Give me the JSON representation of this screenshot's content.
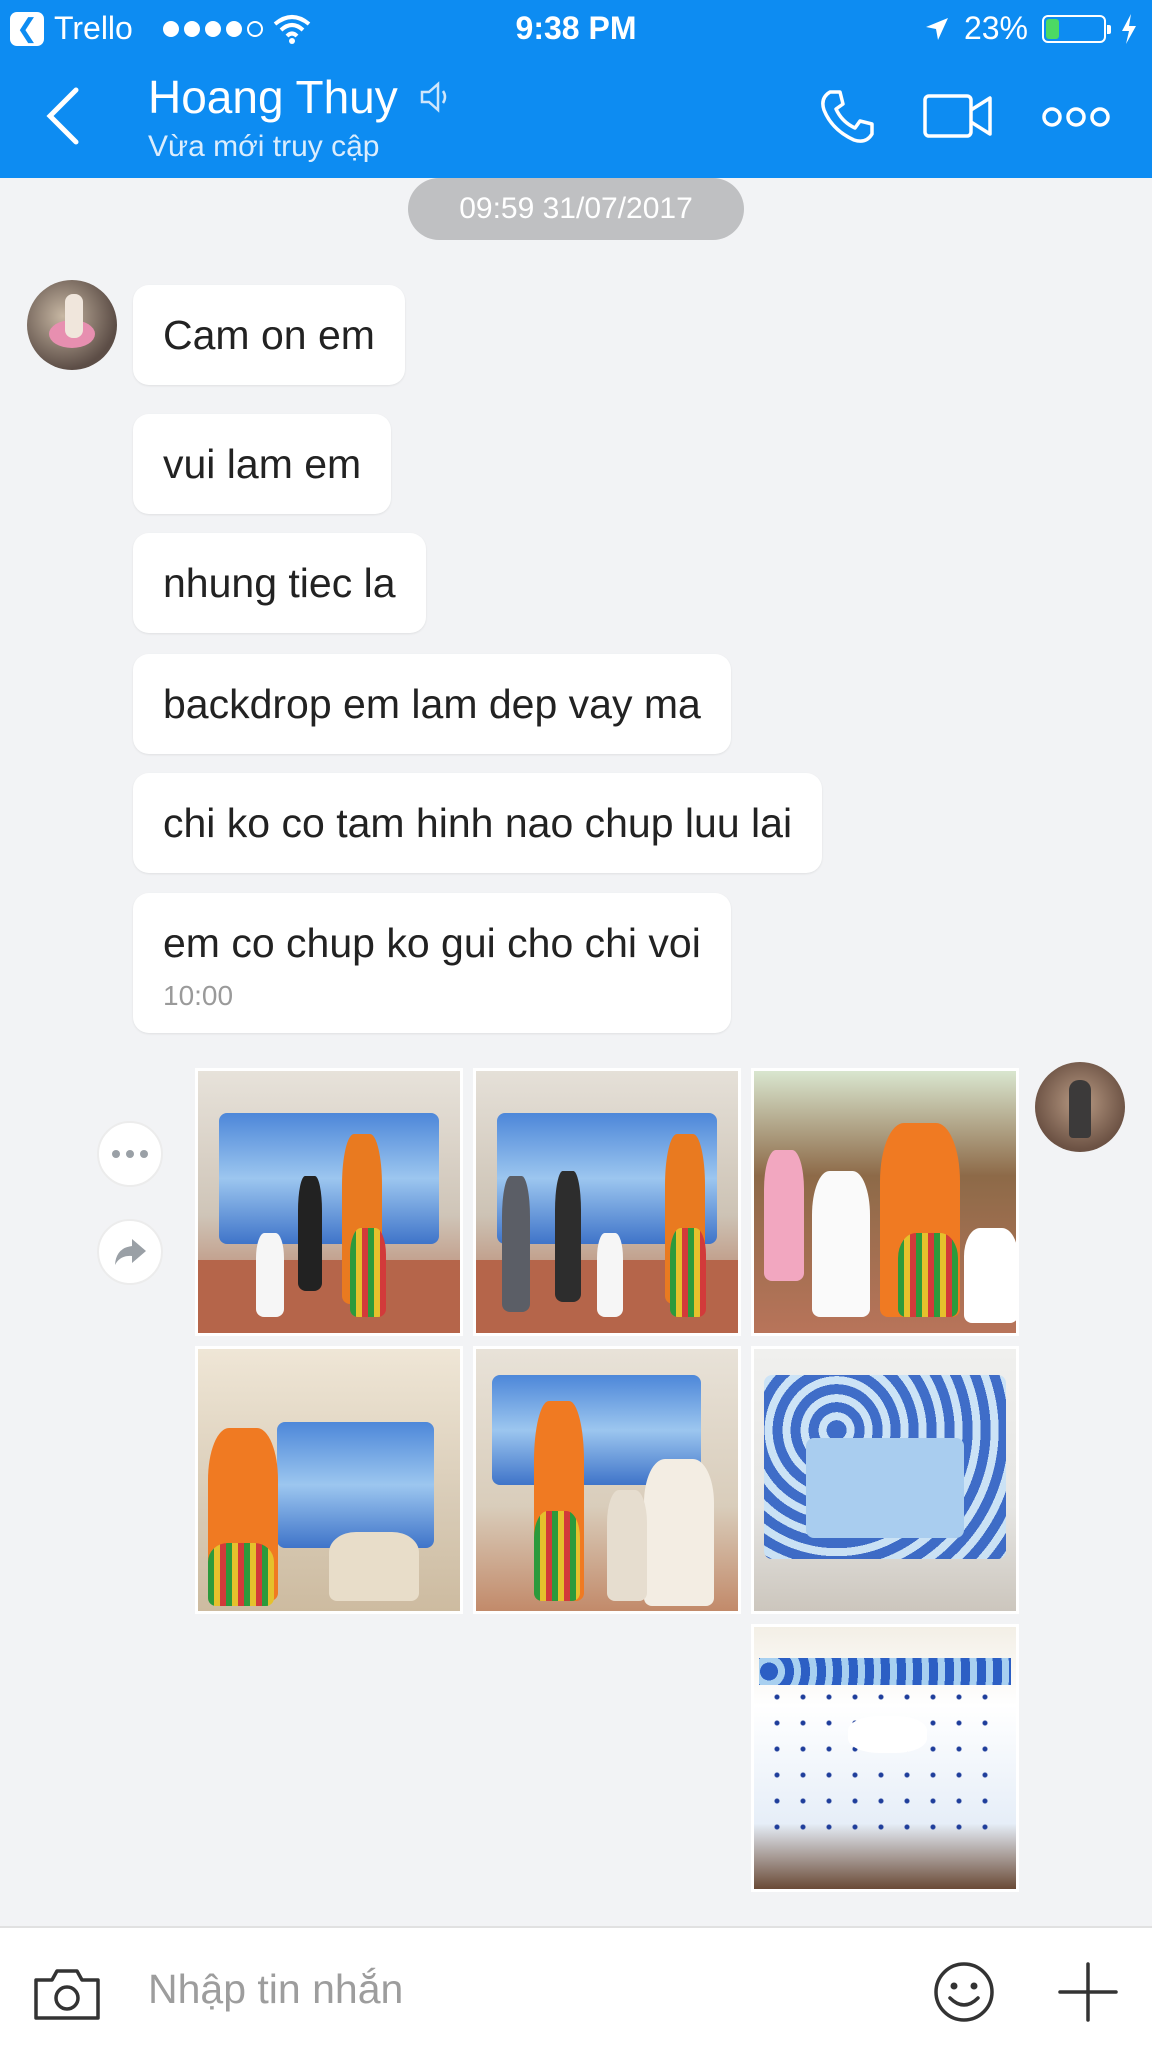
{
  "status_bar": {
    "app_back_label": "Trello",
    "time": "9:38 PM",
    "battery_percent": "23%",
    "battery_level": 0.23,
    "signal_bars_filled": 4,
    "signal_bars_total": 5,
    "icons": [
      "trello-back-icon",
      "signal-dots-icon",
      "wifi-icon",
      "location-arrow-icon",
      "battery-icon",
      "charging-bolt-icon"
    ]
  },
  "header": {
    "title": "Hoang Thuy",
    "subtitle": "Vừa mới truy cập",
    "background_color": "#0d8cf2",
    "icons": [
      "back-chevron-icon",
      "speaker-muted-icon",
      "phone-icon",
      "video-camera-icon",
      "more-options-icon"
    ]
  },
  "chat": {
    "date_divider": "09:59 31/07/2017",
    "messages": [
      {
        "text": "Cam on em"
      },
      {
        "text": "vui lam em"
      },
      {
        "text": "nhung tiec la"
      },
      {
        "text": "backdrop em lam dep vay ma"
      },
      {
        "text": "chi ko co tam hinh nao chup luu lai"
      },
      {
        "text": "em co chup ko gui cho chi voi",
        "time": "10:00"
      }
    ],
    "photo_count": 7
  },
  "input_bar": {
    "placeholder": "Nhập tin nhắn",
    "icons": [
      "camera-icon",
      "emoji-icon",
      "plus-icon"
    ]
  }
}
